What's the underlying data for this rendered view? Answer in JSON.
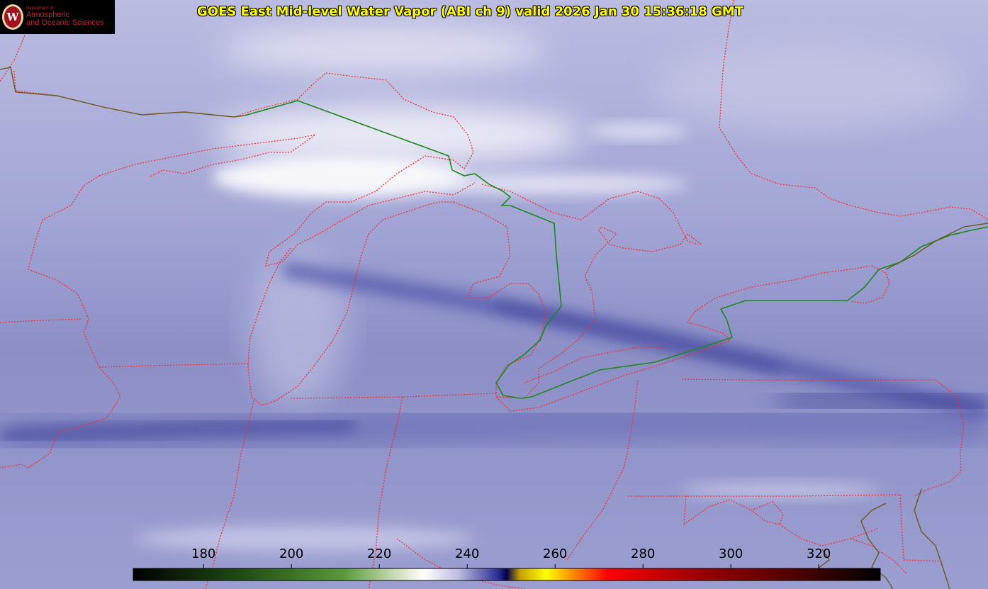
{
  "header": {
    "title": "GOES East Mid-level Water Vapor (ABI ch 9)  valid 2026 Jan 30 15:36:18 GMT"
  },
  "logo": {
    "dept_line": "Department of",
    "line2": "Atmospheric",
    "line3": "and Oceanic Sciences",
    "seal_letter": "W"
  },
  "colorbar": {
    "range": [
      164,
      334
    ],
    "tick_values": [
      180,
      200,
      220,
      240,
      260,
      280,
      300,
      320
    ],
    "ticks": [
      "180",
      "200",
      "220",
      "240",
      "260",
      "280",
      "300",
      "320"
    ],
    "stops": [
      {
        "value": 164,
        "color": "#000000"
      },
      {
        "value": 188,
        "color": "#1e4a12"
      },
      {
        "value": 212,
        "color": "#5a9a3a"
      },
      {
        "value": 226,
        "color": "#dfe8d0"
      },
      {
        "value": 230,
        "color": "#ffffff"
      },
      {
        "value": 238,
        "color": "#bcbde0"
      },
      {
        "value": 247,
        "color": "#2a2f96"
      },
      {
        "value": 249,
        "color": "#00004a"
      },
      {
        "value": 252,
        "color": "#c8a000"
      },
      {
        "value": 258,
        "color": "#ffff00"
      },
      {
        "value": 264,
        "color": "#ff8c00"
      },
      {
        "value": 272,
        "color": "#ff0000"
      },
      {
        "value": 292,
        "color": "#a00000"
      },
      {
        "value": 312,
        "color": "#5a0000"
      },
      {
        "value": 334,
        "color": "#000000"
      }
    ]
  },
  "colors": {
    "state_borders": "#ff2a2a",
    "international_border": "#1a8a1a",
    "coastline": "#6b5a1a",
    "background": "#8f92c6"
  }
}
